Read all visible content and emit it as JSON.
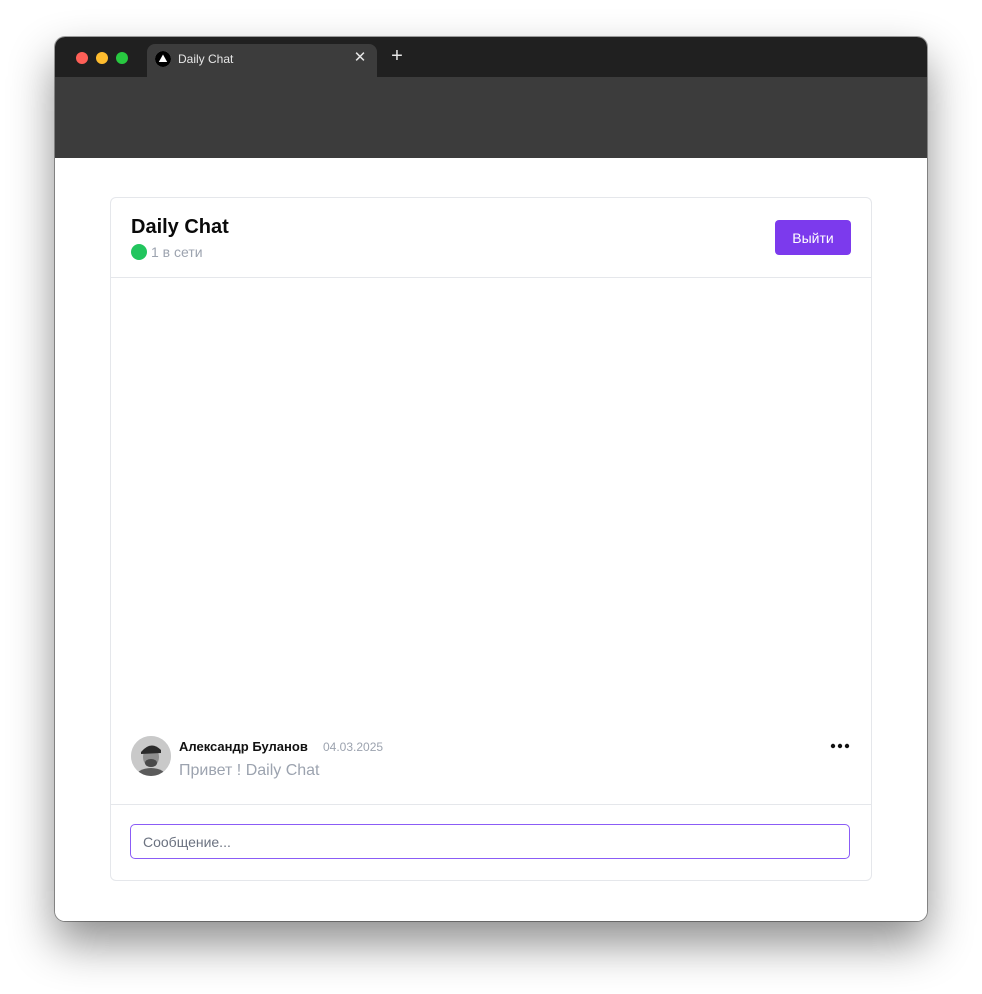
{
  "browser": {
    "tab_title": "Daily Chat",
    "tab_close": "✕",
    "new_tab": "+"
  },
  "chat": {
    "title": "Daily Chat",
    "online_count": "1 в сети",
    "online_color": "#22c55e",
    "logout_label": "Выйти",
    "accent_color": "#7c3aed"
  },
  "messages": [
    {
      "author": "Александр Буланов",
      "date": "04.03.2025",
      "text": "Привет ! Daily Chat",
      "avatar_icon": "user-photo"
    }
  ],
  "composer": {
    "placeholder": "Сообщение...",
    "value": ""
  }
}
